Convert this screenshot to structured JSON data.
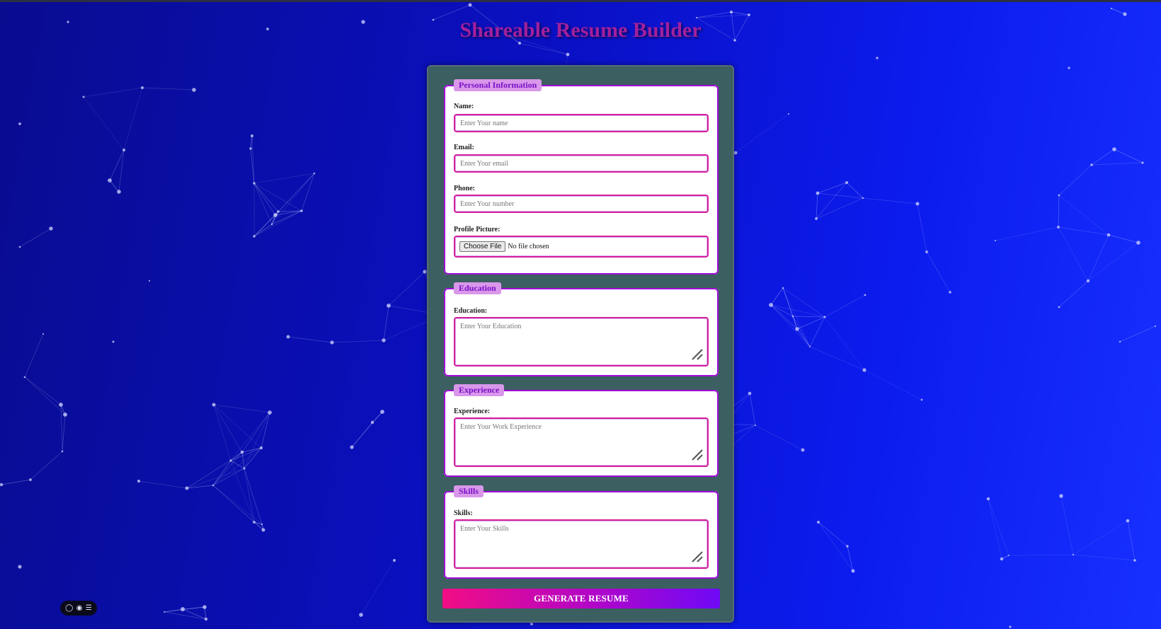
{
  "page": {
    "title": "Shareable Resume Builder",
    "colors": {
      "background_start": "#090c8f",
      "background_end": "#1730ff",
      "title": "#a2209c",
      "card": "#3c5f61",
      "section_border": "#a00bd8",
      "input_border": "#d5209b",
      "legend_bg": "#d997ea",
      "button_gradient_start": "#f20d84",
      "button_gradient_end": "#6f09f6"
    }
  },
  "form": {
    "personal": {
      "legend": "Personal Information",
      "name_label": "Name:",
      "name_placeholder": "Enter Your name",
      "email_label": "Email:",
      "email_placeholder": "Enter Your email",
      "phone_label": "Phone:",
      "phone_placeholder": "Enter Your number",
      "picture_label": "Profile Picture:",
      "choose_file_label": "Choose File",
      "file_status": "No file chosen"
    },
    "education": {
      "legend": "Education",
      "label": "Education:",
      "placeholder": "Enter Your Education"
    },
    "experience": {
      "legend": "Experience",
      "label": "Experience:",
      "placeholder": "Enter Your Work Experience"
    },
    "skills": {
      "legend": "Skills",
      "label": "Skills:",
      "placeholder": "Enter Your Skills"
    },
    "submit_label": "GENERATE RESUME"
  },
  "widget": {
    "icons": [
      "chat-icon",
      "eye-icon",
      "menu-icon"
    ]
  }
}
